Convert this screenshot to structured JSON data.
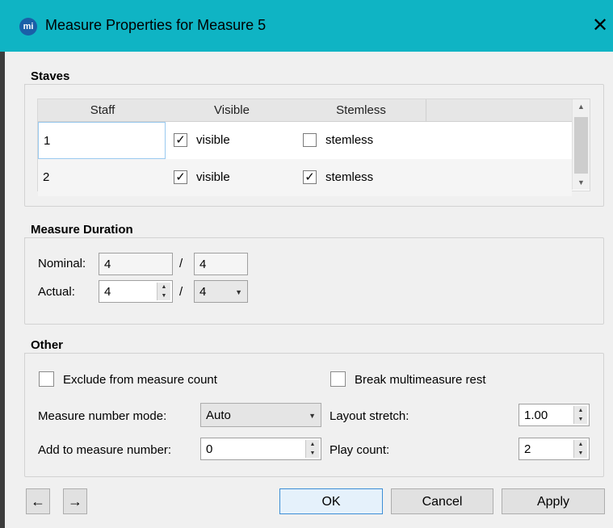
{
  "window": {
    "title": "Measure Properties for Measure 5",
    "app_icon": "mi",
    "close_glyph": "✕",
    "accent_color": "#0fb4c4"
  },
  "staves": {
    "heading": "Staves",
    "columns": [
      "Staff",
      "Visible",
      "Stemless"
    ],
    "rows": [
      {
        "staff": "1",
        "visible": true,
        "visible_label": "visible",
        "stemless": false,
        "stemless_label": "stemless"
      },
      {
        "staff": "2",
        "visible": true,
        "visible_label": "visible",
        "stemless": true,
        "stemless_label": "stemless"
      }
    ]
  },
  "duration": {
    "heading": "Measure Duration",
    "nominal_label": "Nominal:",
    "nominal_numerator": "4",
    "nominal_denominator": "4",
    "actual_label": "Actual:",
    "actual_numerator": "4",
    "actual_denominator": "4",
    "separator": "/"
  },
  "other": {
    "heading": "Other",
    "exclude_label": "Exclude from measure count",
    "exclude_checked": false,
    "break_label": "Break multimeasure rest",
    "break_checked": false,
    "mode_label": "Measure number mode:",
    "mode_value": "Auto",
    "add_label": "Add to measure number:",
    "add_value": "0",
    "stretch_label": "Layout stretch:",
    "stretch_value": "1.00",
    "play_label": "Play count:",
    "play_value": "2"
  },
  "footer": {
    "prev_glyph": "←",
    "next_glyph": "→",
    "ok_label": "OK",
    "cancel_label": "Cancel",
    "apply_label": "Apply"
  }
}
